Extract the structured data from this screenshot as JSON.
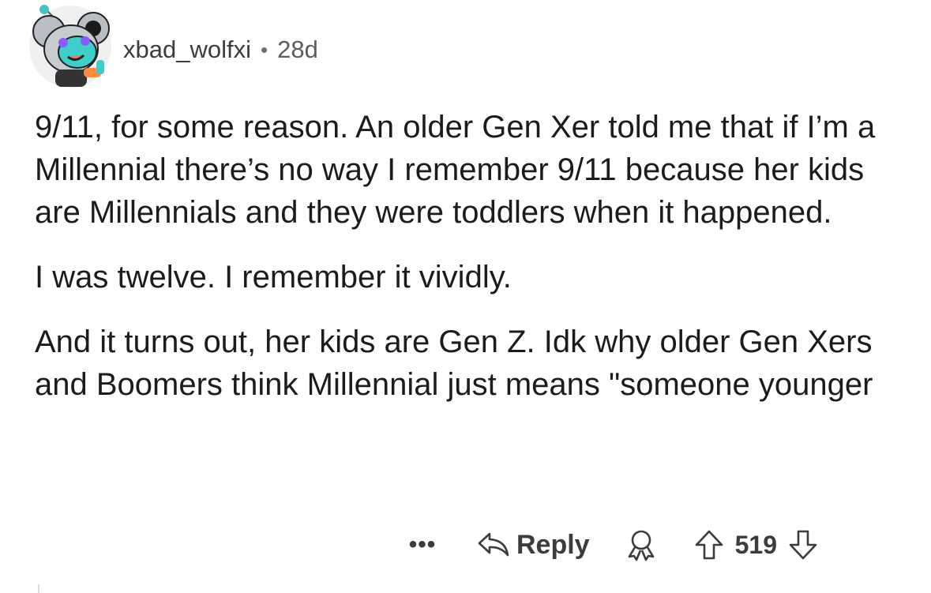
{
  "comment": {
    "username": "xbad_wolfxi",
    "separator": "•",
    "age": "28d",
    "paragraphs": [
      "9/11, for some reason. An older Gen Xer told me that if I’m a Millennial there’s no way I remember 9/11 because her kids are Millennials and they were toddlers when it happened.",
      "I was twelve. I remember it vividly.",
      "And it turns out, her kids are Gen Z. Idk why older Gen Xers and Boomers think Millennial just means \"someone younger"
    ]
  },
  "actions": {
    "more_label": "•••",
    "reply_label": "Reply",
    "score": "519"
  },
  "icons": {
    "avatar": "koala-snoo-avatar",
    "reply": "reply-arrow-icon",
    "award": "award-icon",
    "upvote": "upvote-arrow-icon",
    "downvote": "downvote-arrow-icon"
  }
}
